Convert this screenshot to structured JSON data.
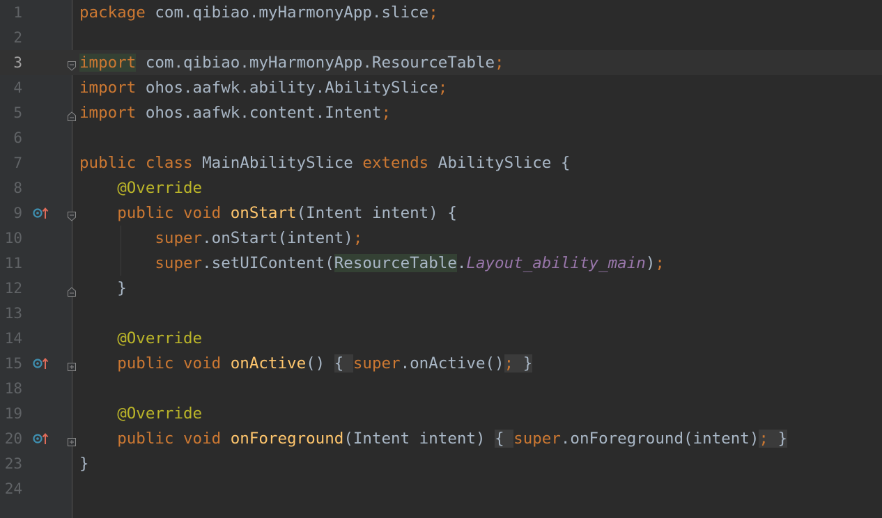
{
  "editor": {
    "lines": [
      {
        "num": "1",
        "tokens": [
          {
            "t": "package",
            "c": "kw"
          },
          {
            "t": " com.qibiao.myHarmonyApp.slice",
            "c": "plain"
          },
          {
            "t": ";",
            "c": "semi"
          }
        ]
      },
      {
        "num": "2",
        "tokens": []
      },
      {
        "num": "3",
        "tokens": [
          {
            "t": "import",
            "c": "kw hl-green"
          },
          {
            "t": " com.qibiao.myHarmonyApp.ResourceTable",
            "c": "plain"
          },
          {
            "t": ";",
            "c": "semi"
          }
        ]
      },
      {
        "num": "4",
        "tokens": [
          {
            "t": "import",
            "c": "kw"
          },
          {
            "t": " ohos.aafwk.ability.AbilitySlice",
            "c": "plain"
          },
          {
            "t": ";",
            "c": "semi"
          }
        ]
      },
      {
        "num": "5",
        "tokens": [
          {
            "t": "import",
            "c": "kw"
          },
          {
            "t": " ohos.aafwk.content.Intent",
            "c": "plain"
          },
          {
            "t": ";",
            "c": "semi"
          }
        ]
      },
      {
        "num": "6",
        "tokens": []
      },
      {
        "num": "7",
        "tokens": [
          {
            "t": "public class",
            "c": "kw"
          },
          {
            "t": " MainAbilitySlice ",
            "c": "plain"
          },
          {
            "t": "extends",
            "c": "kw"
          },
          {
            "t": " AbilitySlice {",
            "c": "plain"
          }
        ]
      },
      {
        "num": "8",
        "tokens": [
          {
            "t": "    ",
            "c": "plain"
          },
          {
            "t": "@Override",
            "c": "ann"
          }
        ]
      },
      {
        "num": "9",
        "tokens": [
          {
            "t": "    ",
            "c": "plain"
          },
          {
            "t": "public void ",
            "c": "kw"
          },
          {
            "t": "onStart",
            "c": "fn"
          },
          {
            "t": "(Intent intent) {",
            "c": "plain"
          }
        ]
      },
      {
        "num": "10",
        "tokens": [
          {
            "t": "        ",
            "c": "plain"
          },
          {
            "t": "super",
            "c": "kw"
          },
          {
            "t": ".onStart(intent)",
            "c": "plain"
          },
          {
            "t": ";",
            "c": "semi"
          }
        ]
      },
      {
        "num": "11",
        "tokens": [
          {
            "t": "        ",
            "c": "plain"
          },
          {
            "t": "super",
            "c": "kw"
          },
          {
            "t": ".setUIContent(",
            "c": "plain"
          },
          {
            "t": "ResourceTable",
            "c": "plain hl-green"
          },
          {
            "t": ".",
            "c": "plain"
          },
          {
            "t": "Layout_ability_main",
            "c": "field"
          },
          {
            "t": ")",
            "c": "plain"
          },
          {
            "t": ";",
            "c": "semi"
          }
        ]
      },
      {
        "num": "12",
        "tokens": [
          {
            "t": "    }",
            "c": "plain"
          }
        ]
      },
      {
        "num": "13",
        "tokens": []
      },
      {
        "num": "14",
        "tokens": [
          {
            "t": "    ",
            "c": "plain"
          },
          {
            "t": "@Override",
            "c": "ann"
          }
        ]
      },
      {
        "num": "15",
        "tokens": [
          {
            "t": "    ",
            "c": "plain"
          },
          {
            "t": "public void ",
            "c": "kw"
          },
          {
            "t": "onActive",
            "c": "fn"
          },
          {
            "t": "()",
            "c": "plain"
          },
          {
            "t": " ",
            "c": "plain"
          },
          {
            "t": "{ ",
            "c": "plain hl-gray"
          },
          {
            "t": "super",
            "c": "kw"
          },
          {
            "t": ".onActive()",
            "c": "plain"
          },
          {
            "t": ";",
            "c": "semi hl-gray"
          },
          {
            "t": " }",
            "c": "plain hl-gray"
          }
        ]
      },
      {
        "num": "18",
        "tokens": []
      },
      {
        "num": "19",
        "tokens": [
          {
            "t": "    ",
            "c": "plain"
          },
          {
            "t": "@Override",
            "c": "ann"
          }
        ]
      },
      {
        "num": "20",
        "tokens": [
          {
            "t": "    ",
            "c": "plain"
          },
          {
            "t": "public void ",
            "c": "kw"
          },
          {
            "t": "onForeground",
            "c": "fn"
          },
          {
            "t": "(Intent intent)",
            "c": "plain"
          },
          {
            "t": " ",
            "c": "plain"
          },
          {
            "t": "{ ",
            "c": "plain hl-gray"
          },
          {
            "t": "super",
            "c": "kw"
          },
          {
            "t": ".onForeground(intent)",
            "c": "plain"
          },
          {
            "t": ";",
            "c": "semi hl-gray"
          },
          {
            "t": " }",
            "c": "plain hl-gray"
          }
        ]
      },
      {
        "num": "23",
        "tokens": [
          {
            "t": "}",
            "c": "plain"
          }
        ]
      },
      {
        "num": "24",
        "tokens": []
      }
    ]
  },
  "gutter_markers": {
    "override_icon": "override-up-arrow-icon",
    "fold_open_icon": "fold-open-icon",
    "fold_end_icon": "fold-end-icon",
    "fold_collapsed_icon": "fold-collapsed-icon"
  },
  "colors": {
    "background": "#2b2b2b",
    "gutter": "#313335",
    "keyword": "#cc7832",
    "plain": "#a9b7c6",
    "annotation": "#bbb529",
    "method": "#ffc66d",
    "static_field": "#9876aa",
    "line_number": "#606366"
  }
}
